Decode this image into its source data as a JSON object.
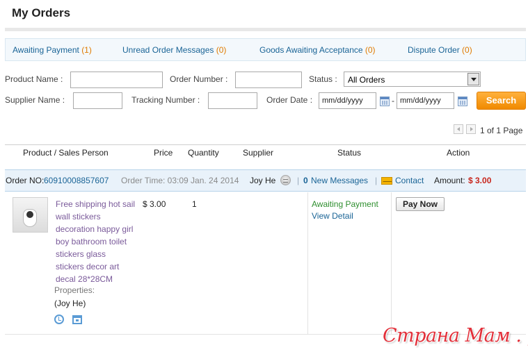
{
  "page": {
    "title": "My Orders"
  },
  "status_tabs": [
    {
      "label": "Awaiting Payment",
      "count": "(1)"
    },
    {
      "label": "Unread Order Messages",
      "count": "(0)"
    },
    {
      "label": "Goods Awaiting Acceptance",
      "count": "(0)"
    },
    {
      "label": "Dispute Order",
      "count": "(0)"
    }
  ],
  "filters": {
    "product_name_label": "Product Name :",
    "order_number_label": "Order Number :",
    "status_label": "Status :",
    "status_value": "All Orders",
    "supplier_name_label": "Supplier Name :",
    "tracking_number_label": "Tracking Number :",
    "order_date_label": "Order Date :",
    "date_from_value": "mm/dd/yyyy",
    "date_to_value": "mm/dd/yyyy",
    "date_separator": "-",
    "search_label": "Search"
  },
  "pagination": {
    "text": "1 of 1 Page"
  },
  "table": {
    "columns": [
      "Product / Sales Person",
      "Price",
      "Quantity",
      "Supplier",
      "Status",
      "Action"
    ]
  },
  "order": {
    "order_no_label": "Order NO:",
    "order_no": "60910008857607",
    "order_time": "Order Time: 03:09 Jan. 24 2014",
    "supplier": "Joy He",
    "new_messages_count": "0",
    "new_messages_label": "New Messages",
    "contact_label": "Contact",
    "amount_label": "Amount:",
    "amount_value": "$ 3.00",
    "separator": "|"
  },
  "product": {
    "title_lines": [
      "Free shipping hot sail",
      "wall stickers",
      "decoration happy girl",
      "boy bathroom toilet",
      "stickers glass",
      "stickers decor art",
      "decal 28*28CM"
    ],
    "properties_label": "Properties:",
    "sales_person": "(Joy He)",
    "price": "$ 3.00",
    "quantity": "1",
    "status": "Awaiting Payment",
    "view_detail": "View Detail",
    "pay_now": "Pay Now"
  },
  "watermark": "Страна Мам . ру",
  "icons": {
    "calendar": "calendar-icon",
    "chat": "chat-icon",
    "mail": "mail-icon",
    "alarm": "alarm-clock-icon",
    "box": "inbox-icon"
  },
  "colors": {
    "link": "#1a6496",
    "count": "#e07b00",
    "search_button": "#f08a00",
    "amount": "#c8261c",
    "status": "#2f8f2f",
    "product_title": "#7a5a9a"
  }
}
